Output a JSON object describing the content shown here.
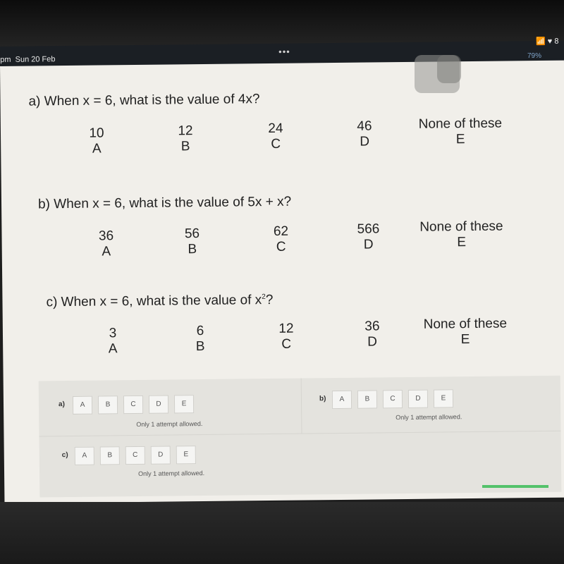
{
  "status_bar": {
    "time": "pm",
    "date": "Sun 20 Feb",
    "multitask_icon": "ellipsis-icon",
    "wifi_icon": "wifi-icon",
    "battery_text": "8",
    "zoom_level": "79%"
  },
  "questions": [
    {
      "label": "a)",
      "text": "When x = 6, what is the value of 4x?",
      "options": [
        {
          "value": "10",
          "letter": "A"
        },
        {
          "value": "12",
          "letter": "B"
        },
        {
          "value": "24",
          "letter": "C"
        },
        {
          "value": "46",
          "letter": "D"
        },
        {
          "value": "None of these",
          "letter": "E"
        }
      ]
    },
    {
      "label": "b)",
      "text": "When x = 6, what is the value of 5x + x?",
      "options": [
        {
          "value": "36",
          "letter": "A"
        },
        {
          "value": "56",
          "letter": "B"
        },
        {
          "value": "62",
          "letter": "C"
        },
        {
          "value": "566",
          "letter": "D"
        },
        {
          "value": "None of these",
          "letter": "E"
        }
      ]
    },
    {
      "label": "c)",
      "text_before": "When x = 6, what is the value of x",
      "superscript": "2",
      "text_after": "?",
      "options": [
        {
          "value": "3",
          "letter": "A"
        },
        {
          "value": "6",
          "letter": "B"
        },
        {
          "value": "12",
          "letter": "C"
        },
        {
          "value": "36",
          "letter": "D"
        },
        {
          "value": "None of these",
          "letter": "E"
        }
      ]
    }
  ],
  "answers": [
    {
      "label": "a)",
      "buttons": [
        "A",
        "B",
        "C",
        "D",
        "E"
      ],
      "note": "Only 1 attempt allowed."
    },
    {
      "label": "b)",
      "buttons": [
        "A",
        "B",
        "C",
        "D",
        "E"
      ],
      "note": "Only 1 attempt allowed."
    },
    {
      "label": "c)",
      "buttons": [
        "A",
        "B",
        "C",
        "D",
        "E"
      ],
      "note": "Only 1 attempt allowed."
    }
  ]
}
